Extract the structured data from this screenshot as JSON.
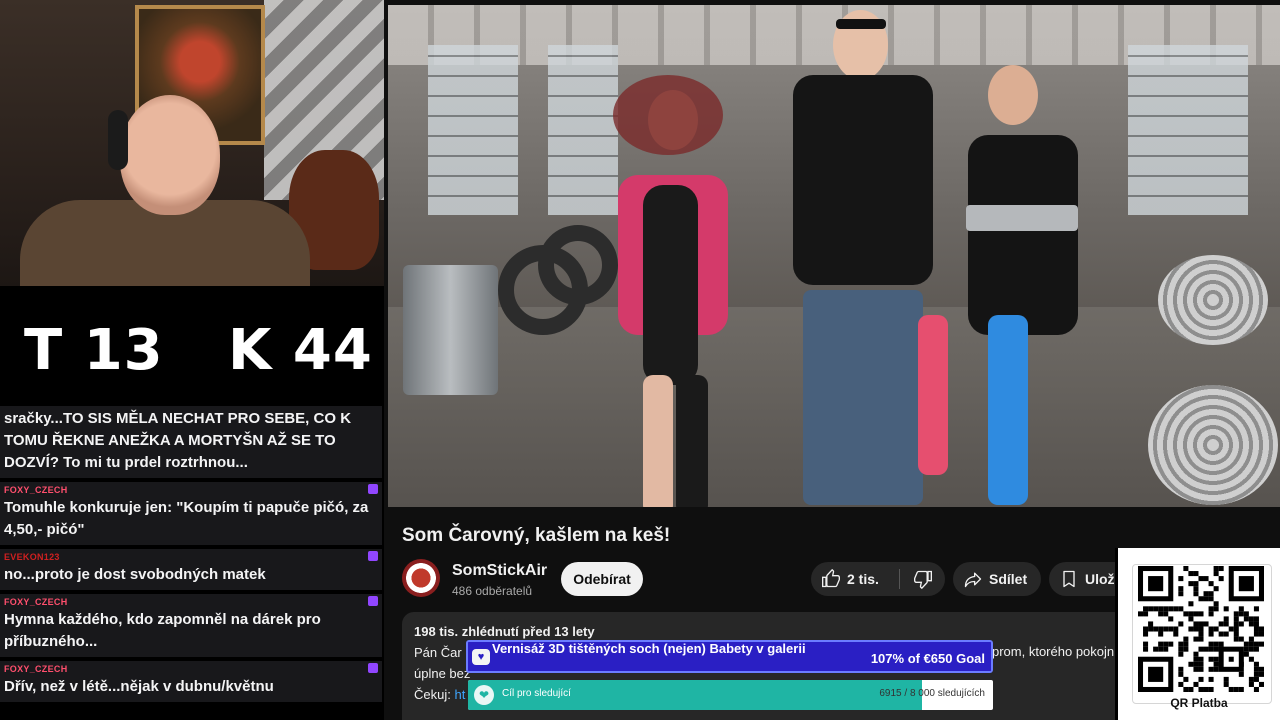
{
  "scoreboard": {
    "t": "T 13",
    "k": "K 44"
  },
  "chat": [
    {
      "user": "",
      "user_color": "#ffffff",
      "text": "sračky...TO SIS MĚLA NECHAT PRO SEBE, CO K TOMU ŘEKNE ANEŽKA A MORTYŠN AŽ SE TO DOZVÍ? To mi tu prdel roztrhnou..."
    },
    {
      "user": "FOXY_CZECH",
      "user_color": "#ff4f6d",
      "text": "Tomuhle konkuruje jen: \"Koupím ti papuče pičó, za 4,50,- pičó\""
    },
    {
      "user": "EVEKON123",
      "user_color": "#d02020",
      "text": "no...proto je dost svobodných matek"
    },
    {
      "user": "FOXY_CZECH",
      "user_color": "#ff4f6d",
      "text": "Hymna každého, kdo zapomněl na dárek pro příbuzného..."
    },
    {
      "user": "FOXY_CZECH",
      "user_color": "#ff4f6d",
      "text": "Dřív, než v létě...nějak v dubnu/květnu"
    }
  ],
  "video": {
    "title": "Som Čarovný, kašlem na keš!",
    "channel": "SomStickAir",
    "subscribers": "486 odběratelů",
    "subscribe_label": "Odebírat",
    "likes": "2 tis.",
    "share_label": "Sdílet",
    "save_label": "Uložit",
    "views_date": "198 tis. zhlédnutí  před 13 lety",
    "desc_line1": "Pán Čar",
    "desc_tail": "prom, ktorého pokojn",
    "desc_line2": "úplne bez",
    "desc_line3_label": "Čekuj:",
    "desc_line3_link": "ht"
  },
  "goals": {
    "donation": {
      "label": "Vernisáž 3D tištěných soch (nejen) Babety v galerii",
      "value": "107% of €650 Goal",
      "progress": 1.0
    },
    "followers": {
      "label": "Cíl pro sledující",
      "value": "6915 / 8 000 sledujících",
      "progress": 0.864
    }
  },
  "qr": {
    "caption": "QR Platba"
  },
  "colors": {
    "accent_blue": "#3ea6ff",
    "goal_purple": "#2a1fc4",
    "goal_teal": "#1fb5a4"
  }
}
